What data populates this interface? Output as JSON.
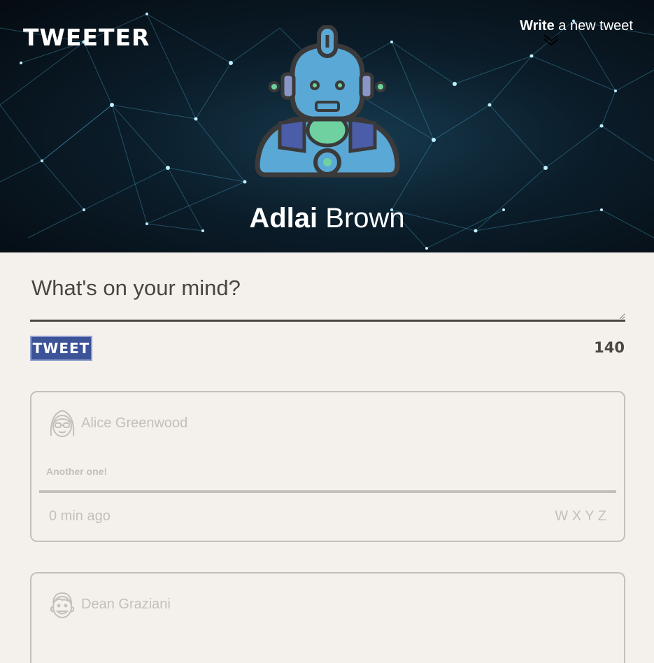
{
  "header": {
    "brand": "TWEETER",
    "write_strong": "Write",
    "write_rest": " a new tweet",
    "user_first": "Adlai",
    "user_last": "Brown"
  },
  "composer": {
    "placeholder": "What's on your mind?",
    "button_label": "TWEET",
    "char_count": "140"
  },
  "tweets": [
    {
      "author": "Alice Greenwood",
      "body": "Another one!",
      "time": "0 min ago",
      "actions": "W X Y Z",
      "avatar_icon": "girl-with-glasses-icon"
    },
    {
      "author": "Dean Graziani",
      "body": "",
      "time": "",
      "actions": "",
      "avatar_icon": "smiling-boy-icon"
    }
  ],
  "colors": {
    "background": "#f4f1ec",
    "text_dark": "#4a4540",
    "button": "#3d5398",
    "muted": "#c3bfbb"
  }
}
